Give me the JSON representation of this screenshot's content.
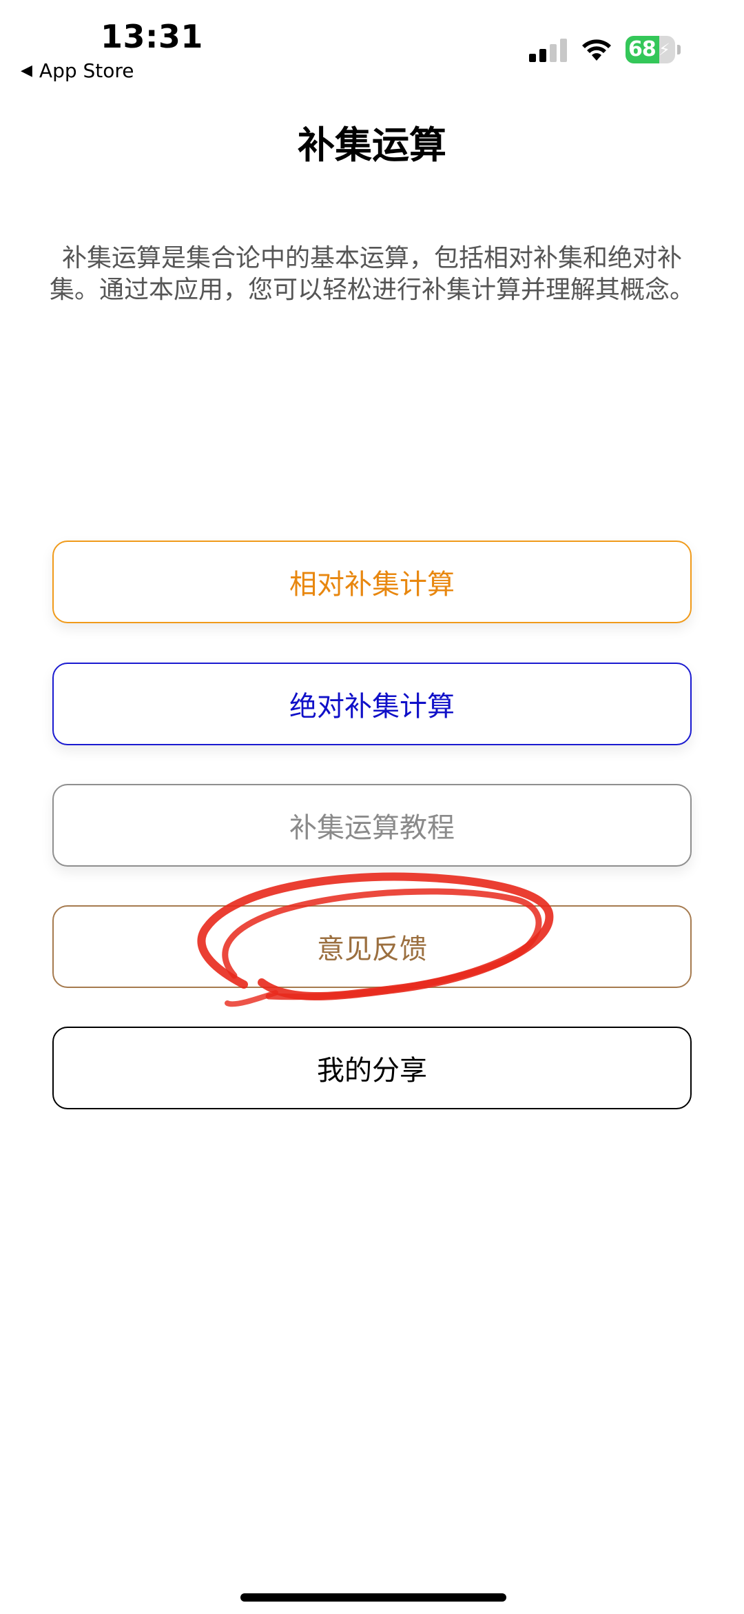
{
  "status_bar": {
    "time": "13:31",
    "back_label": "App Store",
    "battery_percent": "68",
    "battery_level": 0.68,
    "battery_color": "#34c759"
  },
  "title": "补集运算",
  "description": "补集运算是集合论中的基本运算，包括相对补集和绝对补集。通过本应用，您可以轻松进行补集计算并理解其概念。",
  "buttons": {
    "relative": "相对补集计算",
    "absolute": "绝对补集计算",
    "tutorial": "补集运算教程",
    "feedback": "意见反馈",
    "share": "我的分享"
  },
  "colors": {
    "relative": "#f09a1a",
    "absolute": "#1a1ad0",
    "tutorial": "#8e8e8e",
    "feedback": "#a57a4e",
    "share": "#000000",
    "annotation": "#e8291c"
  },
  "icons": {
    "back": "back-arrow-icon",
    "signal": "cellular-signal-icon",
    "wifi": "wifi-icon",
    "battery": "battery-charging-icon"
  }
}
